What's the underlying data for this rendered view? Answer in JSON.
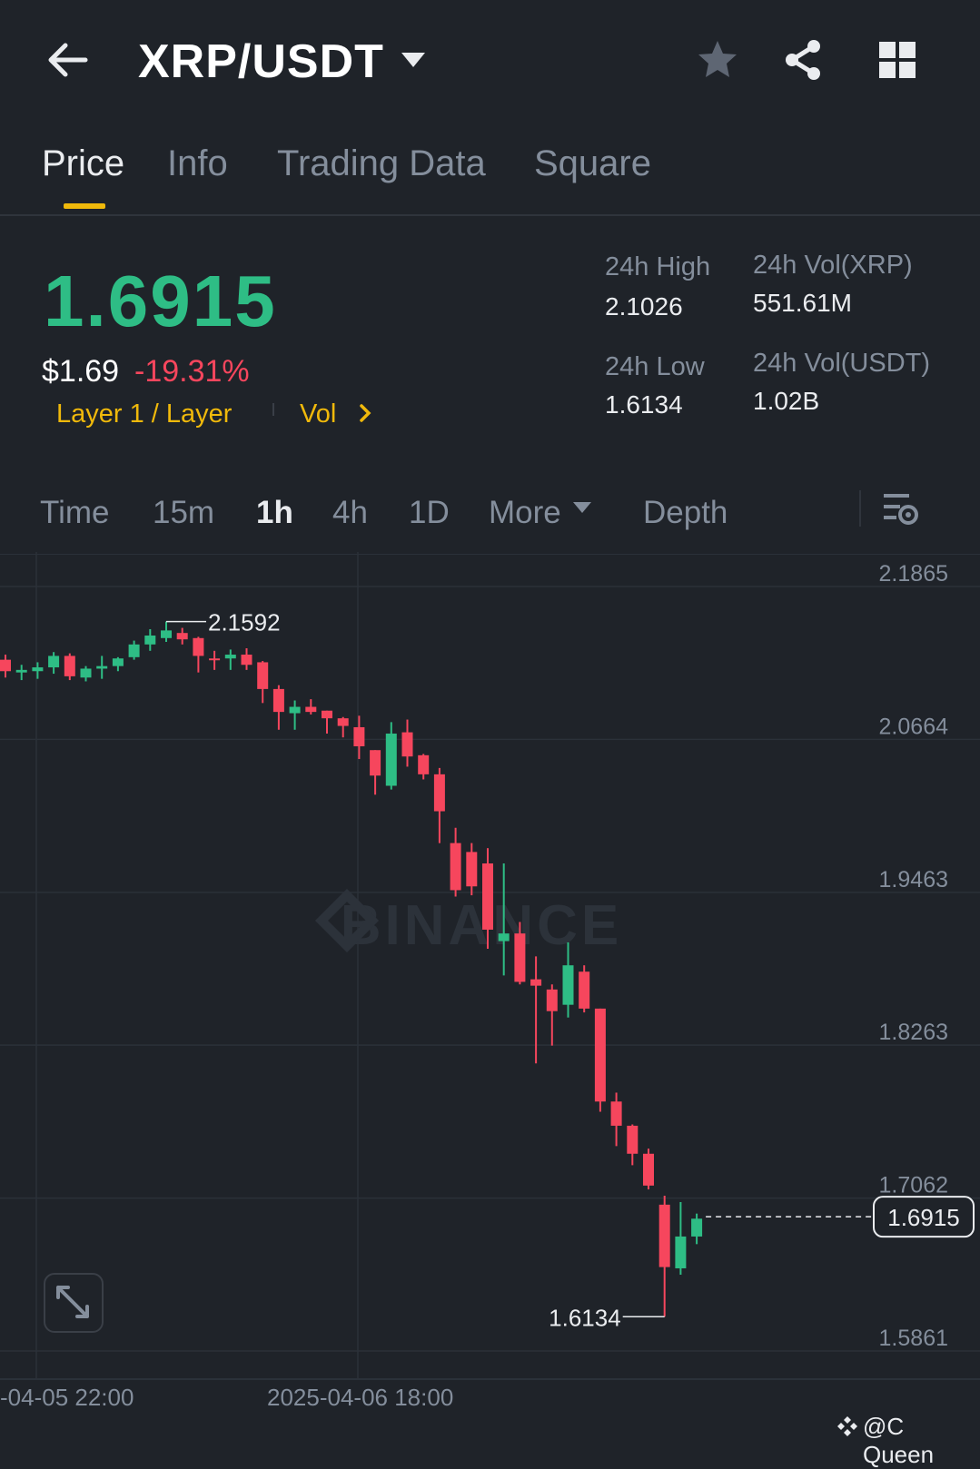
{
  "header": {
    "pair": "XRP/USDT",
    "icons": [
      "back-arrow-icon",
      "dropdown-caret-icon",
      "star-icon",
      "share-icon",
      "grid-menu-icon"
    ]
  },
  "tabs": [
    {
      "label": "Price",
      "active": true
    },
    {
      "label": "Info"
    },
    {
      "label": "Trading Data"
    },
    {
      "label": "Square"
    }
  ],
  "ticker": {
    "last_price": "1.6915",
    "fiat_price": "$1.69",
    "change_pct": "-19.31%",
    "tag_category": "Layer 1 / Layer",
    "tag_vol": "Vol",
    "high_label": "24h High",
    "high_value": "2.1026",
    "low_label": "24h Low",
    "low_value": "1.6134",
    "vol_base_label": "24h Vol(XRP)",
    "vol_base_value": "551.61M",
    "vol_quote_label": "24h Vol(USDT)",
    "vol_quote_value": "1.02B"
  },
  "intervals": {
    "items": [
      "Time",
      "15m",
      "1h",
      "4h",
      "1D",
      "More",
      "Depth"
    ],
    "active": "1h"
  },
  "colors": {
    "up": "#2ebd85",
    "down": "#f6465d",
    "accent": "#f0b90b",
    "background": "#1f2329"
  },
  "chart_data": {
    "type": "candlestick",
    "interval": "1h",
    "ylim": [
      1.5861,
      2.1865
    ],
    "y_ticks": [
      "2.1865",
      "2.0664",
      "1.9463",
      "1.8263",
      "1.7062",
      "1.5861"
    ],
    "x_ticks": [
      "-04-05 22:00",
      "2025-04-06 18:00"
    ],
    "annotations": {
      "high_marker": "2.1592",
      "low_marker": "1.6134",
      "current_price": "1.6915"
    },
    "watermark": "BINANCE",
    "candles": [
      [
        2.129,
        2.133,
        2.115,
        2.12
      ],
      [
        2.119,
        2.125,
        2.113,
        2.121
      ],
      [
        2.12,
        2.127,
        2.114,
        2.123
      ],
      [
        2.123,
        2.135,
        2.118,
        2.132
      ],
      [
        2.132,
        2.134,
        2.113,
        2.116
      ],
      [
        2.115,
        2.124,
        2.112,
        2.122
      ],
      [
        2.122,
        2.132,
        2.114,
        2.124
      ],
      [
        2.124,
        2.131,
        2.12,
        2.13
      ],
      [
        2.131,
        2.144,
        2.129,
        2.141
      ],
      [
        2.141,
        2.153,
        2.136,
        2.148
      ],
      [
        2.146,
        2.159,
        2.143,
        2.152
      ],
      [
        2.15,
        2.154,
        2.141,
        2.145
      ],
      [
        2.146,
        2.147,
        2.119,
        2.132
      ],
      [
        2.13,
        2.136,
        2.121,
        2.129
      ],
      [
        2.13,
        2.137,
        2.121,
        2.133
      ],
      [
        2.133,
        2.138,
        2.121,
        2.125
      ],
      [
        2.127,
        2.128,
        2.095,
        2.106
      ],
      [
        2.106,
        2.109,
        2.074,
        2.088
      ],
      [
        2.087,
        2.097,
        2.074,
        2.092
      ],
      [
        2.092,
        2.098,
        2.086,
        2.088
      ],
      [
        2.089,
        2.089,
        2.071,
        2.083
      ],
      [
        2.083,
        2.084,
        2.068,
        2.077
      ],
      [
        2.076,
        2.085,
        2.051,
        2.061
      ],
      [
        2.058,
        2.058,
        2.023,
        2.038
      ],
      [
        2.03,
        2.08,
        2.027,
        2.071
      ],
      [
        2.072,
        2.082,
        2.045,
        2.053
      ],
      [
        2.054,
        2.055,
        2.035,
        2.039
      ],
      [
        2.039,
        2.044,
        1.985,
        2.01
      ],
      [
        1.985,
        1.997,
        1.943,
        1.948
      ],
      [
        1.978,
        1.985,
        1.944,
        1.951
      ],
      [
        1.969,
        1.981,
        1.902,
        1.917
      ],
      [
        1.908,
        1.969,
        1.881,
        1.914
      ],
      [
        1.914,
        1.923,
        1.874,
        1.876
      ],
      [
        1.878,
        1.896,
        1.812,
        1.873
      ],
      [
        1.87,
        1.874,
        1.826,
        1.853
      ],
      [
        1.858,
        1.907,
        1.848,
        1.889
      ],
      [
        1.884,
        1.889,
        1.852,
        1.855
      ],
      [
        1.855,
        1.855,
        1.774,
        1.782
      ],
      [
        1.782,
        1.789,
        1.747,
        1.763
      ],
      [
        1.763,
        1.764,
        1.732,
        1.741
      ],
      [
        1.741,
        1.745,
        1.713,
        1.716
      ],
      [
        1.701,
        1.708,
        1.613,
        1.652
      ],
      [
        1.651,
        1.703,
        1.646,
        1.676
      ],
      [
        1.676,
        1.694,
        1.67,
        1.69
      ]
    ]
  },
  "watermark_text": "@C Queen"
}
